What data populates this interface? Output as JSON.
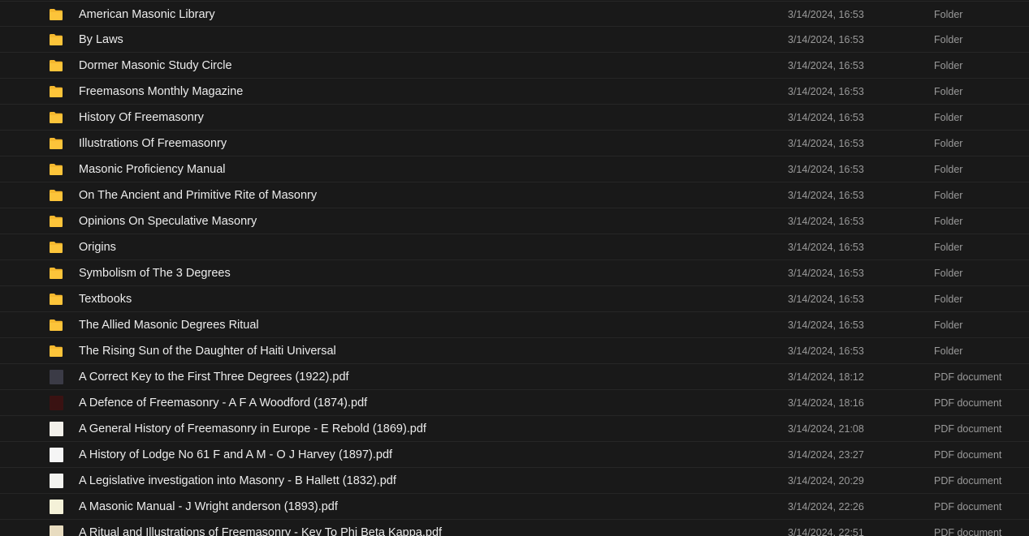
{
  "files": [
    {
      "name": "American Masonic Library",
      "date": "3/14/2024, 16:53",
      "type": "Folder",
      "icon": "folder-icon"
    },
    {
      "name": "By Laws",
      "date": "3/14/2024, 16:53",
      "type": "Folder",
      "icon": "folder-icon"
    },
    {
      "name": "Dormer Masonic Study Circle",
      "date": "3/14/2024, 16:53",
      "type": "Folder",
      "icon": "folder-icon"
    },
    {
      "name": "Freemasons Monthly Magazine",
      "date": "3/14/2024, 16:53",
      "type": "Folder",
      "icon": "folder-icon"
    },
    {
      "name": "History Of Freemasonry",
      "date": "3/14/2024, 16:53",
      "type": "Folder",
      "icon": "folder-icon"
    },
    {
      "name": "Illustrations Of Freemasonry",
      "date": "3/14/2024, 16:53",
      "type": "Folder",
      "icon": "folder-icon"
    },
    {
      "name": "Masonic Proficiency Manual",
      "date": "3/14/2024, 16:53",
      "type": "Folder",
      "icon": "folder-icon"
    },
    {
      "name": "On The Ancient and Primitive Rite of Masonry",
      "date": "3/14/2024, 16:53",
      "type": "Folder",
      "icon": "folder-icon"
    },
    {
      "name": "Opinions On Speculative Masonry",
      "date": "3/14/2024, 16:53",
      "type": "Folder",
      "icon": "folder-icon"
    },
    {
      "name": "Origins",
      "date": "3/14/2024, 16:53",
      "type": "Folder",
      "icon": "folder-icon"
    },
    {
      "name": "Symbolism of The 3 Degrees",
      "date": "3/14/2024, 16:53",
      "type": "Folder",
      "icon": "folder-icon"
    },
    {
      "name": "Textbooks",
      "date": "3/14/2024, 16:53",
      "type": "Folder",
      "icon": "folder-icon"
    },
    {
      "name": "The Allied Masonic Degrees Ritual",
      "date": "3/14/2024, 16:53",
      "type": "Folder",
      "icon": "folder-icon"
    },
    {
      "name": "The Rising Sun of the Daughter of Haiti Universal",
      "date": "3/14/2024, 16:53",
      "type": "Folder",
      "icon": "folder-icon"
    },
    {
      "name": "A Correct Key to the First Three Degrees (1922).pdf",
      "date": "3/14/2024, 18:12",
      "type": "PDF document",
      "icon": "pdf-thumbnail-icon",
      "thumb_color": "#3b3b46"
    },
    {
      "name": "A Defence of Freemasonry - A F A Woodford (1874).pdf",
      "date": "3/14/2024, 18:16",
      "type": "PDF document",
      "icon": "pdf-thumbnail-icon",
      "thumb_color": "#3a1212"
    },
    {
      "name": "A General History of Freemasonry in Europe - E Rebold (1869).pdf",
      "date": "3/14/2024, 21:08",
      "type": "PDF document",
      "icon": "pdf-thumbnail-icon",
      "thumb_color": "#f2f0ea"
    },
    {
      "name": "A History of Lodge No 61 F and A M - O J Harvey (1897).pdf",
      "date": "3/14/2024, 23:27",
      "type": "PDF document",
      "icon": "pdf-thumbnail-icon",
      "thumb_color": "#f5f5f5"
    },
    {
      "name": "A Legislative investigation into Masonry - B Hallett (1832).pdf",
      "date": "3/14/2024, 20:29",
      "type": "PDF document",
      "icon": "pdf-thumbnail-icon",
      "thumb_color": "#f3f3f0"
    },
    {
      "name": "A Masonic Manual - J Wright anderson (1893).pdf",
      "date": "3/14/2024, 22:26",
      "type": "PDF document",
      "icon": "pdf-thumbnail-icon",
      "thumb_color": "#f4f1d8"
    },
    {
      "name": "A Ritual and Illustrations of Freemasonry - Key To Phi Beta Kappa.pdf",
      "date": "3/14/2024, 22:51",
      "type": "PDF document",
      "icon": "pdf-thumbnail-icon",
      "thumb_color": "#e8dcc0"
    }
  ],
  "colors": {
    "background": "#191919",
    "folder": "#f5b82e",
    "text": "#ececec",
    "muted": "#9a9a9a",
    "divider": "#262626"
  }
}
